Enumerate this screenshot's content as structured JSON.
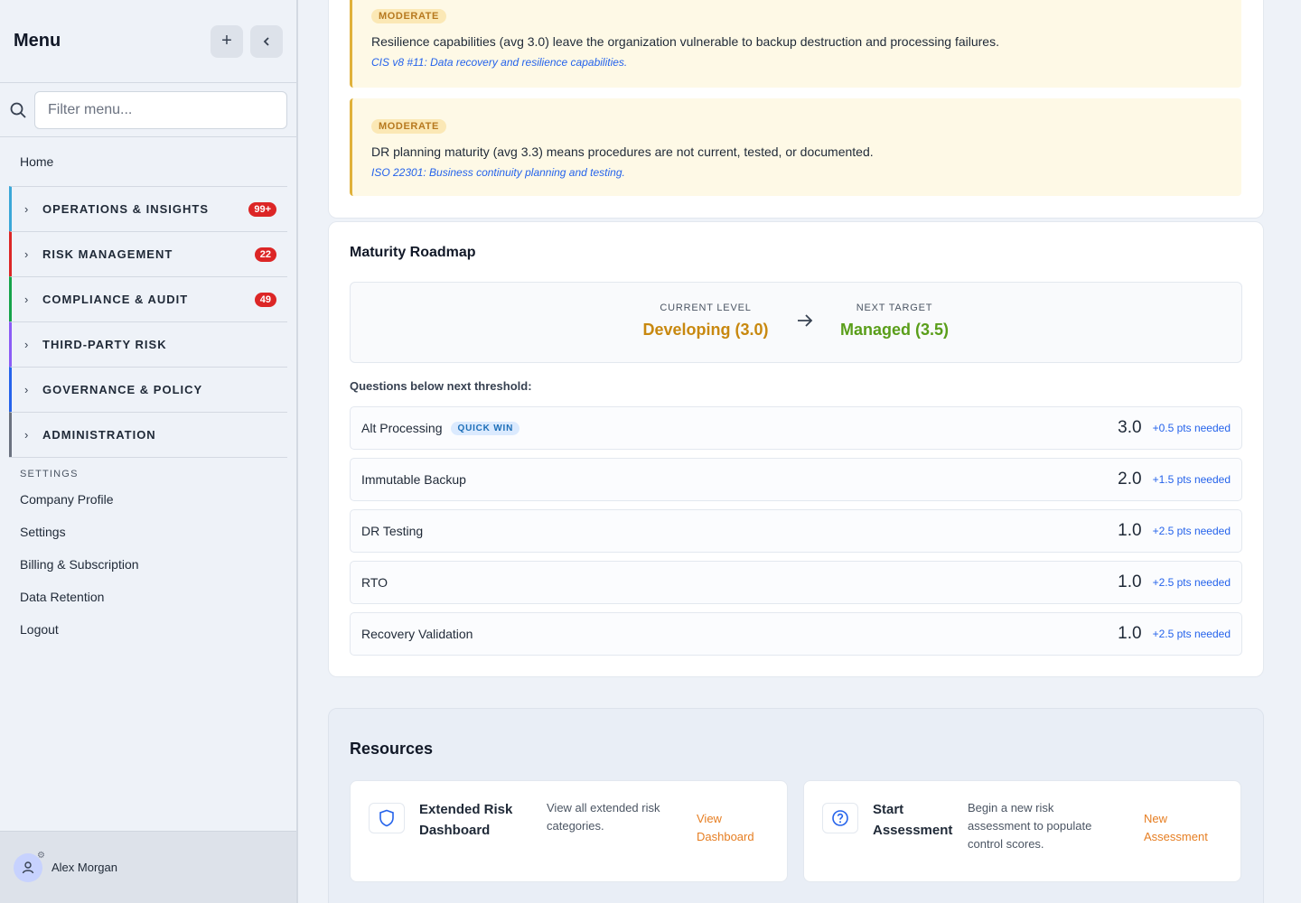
{
  "sidebar": {
    "title": "Menu",
    "add_icon": "plus-icon",
    "collapse_icon": "chevron-left-icon",
    "search_placeholder": "Filter menu...",
    "home": "Home",
    "groups": [
      {
        "label": "OPERATIONS & INSIGHTS",
        "badge": "99+",
        "color": "#3ba7d8"
      },
      {
        "label": "RISK MANAGEMENT",
        "badge": "22",
        "color": "#dc2626"
      },
      {
        "label": "COMPLIANCE & AUDIT",
        "badge": "49",
        "color": "#16a34a"
      },
      {
        "label": "THIRD-PARTY RISK",
        "badge": "",
        "color": "#8b5cf6"
      },
      {
        "label": "GOVERNANCE & POLICY",
        "badge": "",
        "color": "#2563eb"
      },
      {
        "label": "ADMINISTRATION",
        "badge": "",
        "color": "#6b7280"
      }
    ],
    "settings_header": "SETTINGS",
    "settings_items": [
      "Company Profile",
      "Settings",
      "Billing & Subscription",
      "Data Retention",
      "Logout"
    ],
    "user": "Alex Morgan"
  },
  "alerts": [
    {
      "severity": "MODERATE",
      "message": "Resilience capabilities (avg 3.0) leave the organization vulnerable to backup destruction and processing failures.",
      "reference": "CIS v8 #11: Data recovery and resilience capabilities."
    },
    {
      "severity": "MODERATE",
      "message": "DR planning maturity (avg 3.3) means procedures are not current, tested, or documented.",
      "reference": "ISO 22301: Business continuity planning and testing."
    }
  ],
  "roadmap": {
    "title": "Maturity Roadmap",
    "current_caption": "CURRENT LEVEL",
    "current_value": "Developing (3.0)",
    "next_caption": "NEXT TARGET",
    "next_value": "Managed (3.5)",
    "questions_header": "Questions below next threshold:",
    "questions": [
      {
        "name": "Alt Processing",
        "tag": "QUICK WIN",
        "score": "3.0",
        "needed": "+0.5 pts needed"
      },
      {
        "name": "Immutable Backup",
        "tag": "",
        "score": "2.0",
        "needed": "+1.5 pts needed"
      },
      {
        "name": "DR Testing",
        "tag": "",
        "score": "1.0",
        "needed": "+2.5 pts needed"
      },
      {
        "name": "RTO",
        "tag": "",
        "score": "1.0",
        "needed": "+2.5 pts needed"
      },
      {
        "name": "Recovery Validation",
        "tag": "",
        "score": "1.0",
        "needed": "+2.5 pts needed"
      }
    ]
  },
  "resources": {
    "title": "Resources",
    "items": [
      {
        "name_line1": "Extended Risk",
        "name_line2": "Dashboard",
        "desc_line1": "View all extended risk",
        "desc_line2": "categories.",
        "desc_line3": "",
        "link_line1": "View",
        "link_line2": "Dashboard",
        "icon": "shield-icon"
      },
      {
        "name_line1": "Start",
        "name_line2": "Assessment",
        "desc_line1": "Begin a new risk",
        "desc_line2": "assessment to populate",
        "desc_line3": "control scores.",
        "link_line1": "New",
        "link_line2": "Assessment",
        "icon": "question-circle-icon"
      }
    ]
  }
}
